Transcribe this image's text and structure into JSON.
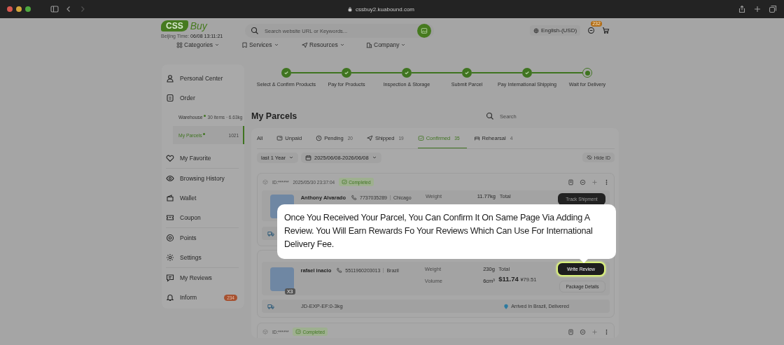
{
  "browser": {
    "url": "cssbuy2.kuabound.com"
  },
  "header": {
    "logo_main": "CSS",
    "logo_accent": "Buy",
    "time_label": "Beijing Time:",
    "time": "06/08 13:11:21",
    "search_placeholder": "Search website URL or Keywords...",
    "language": "English-(USD)",
    "message_badge": "232"
  },
  "nav": [
    "Categories",
    "Services",
    "Resources",
    "Company"
  ],
  "sidebar": {
    "items": [
      {
        "label": "Personal Center",
        "selected": false
      },
      {
        "label": "Order",
        "selected": false,
        "children": [
          {
            "label": "Warehouse",
            "meta": "30 items · 6.63kg",
            "selected": false
          },
          {
            "label": "My Parcels",
            "meta": "1021",
            "selected": true
          }
        ]
      },
      {
        "label": "My Favorite",
        "selected": false
      },
      {
        "label": "Browsing History",
        "selected": false
      },
      {
        "label": "Wallet",
        "selected": false
      },
      {
        "label": "Coupon",
        "selected": false
      },
      {
        "label": "Points",
        "selected": false
      },
      {
        "label": "Settings",
        "selected": false
      },
      {
        "label": "My Reviews",
        "selected": false
      },
      {
        "label": "Inform",
        "selected": false,
        "badge": "234"
      }
    ]
  },
  "steps": [
    {
      "label": "Select & Confirm Products",
      "done": true
    },
    {
      "label": "Pay for Products",
      "done": true
    },
    {
      "label": "Inspection & Storage",
      "done": true
    },
    {
      "label": "Submit Parcel",
      "done": true
    },
    {
      "label": "Pay International Shipping",
      "done": true
    },
    {
      "label": "Wait for Delivery",
      "done": false
    }
  ],
  "title": "My Parcels",
  "search_placeholder": "Search",
  "tabs": [
    {
      "label": "All",
      "selected": false
    },
    {
      "label": "Unpaid",
      "selected": false
    },
    {
      "label": "Pending",
      "count": "20",
      "selected": false
    },
    {
      "label": "Shipped",
      "count": "19",
      "selected": false
    },
    {
      "label": "Confirmed",
      "count": "35",
      "selected": true
    },
    {
      "label": "Rehearsal",
      "count": "4",
      "selected": false
    }
  ],
  "filters": {
    "period": "last 1 Year",
    "date_range": "2025/06/08-2026/06/08",
    "hide_id": "Hide ID"
  },
  "parcels": [
    {
      "id": "ID:******",
      "date": "2025/05/30 23:37:04",
      "status": "Completed",
      "name": "Anthony Alvarado",
      "phone": "7737035289",
      "city": "Chicago",
      "weight_label": "Weight",
      "weight": "11.77kg",
      "total_label": "Total",
      "action": "Track Shipment"
    },
    {
      "name": "rafael inacio",
      "phone": "5511960203013",
      "city": "Brazil",
      "weight_label": "Weight",
      "weight": "230g",
      "volume_label": "Volume",
      "volume": "6cm³",
      "total_label": "Total",
      "total": "$11.74",
      "total_cny": "¥79.51",
      "quantity": "X3",
      "action": "Write Review",
      "secondary_action": "Package Details",
      "route": "JD-EXP-EF:0-3kg",
      "tracking": "Arrived In Brazil, Delivered"
    },
    {
      "id": "ID:******",
      "status": "Completed"
    }
  ],
  "tooltip": "Once You Received Your Parcel, You Can Confirm It On Same Page Via Adding A Review. You Will Earn Rewards Fo Your Reviews Which Can Use For International Delivery Fee."
}
